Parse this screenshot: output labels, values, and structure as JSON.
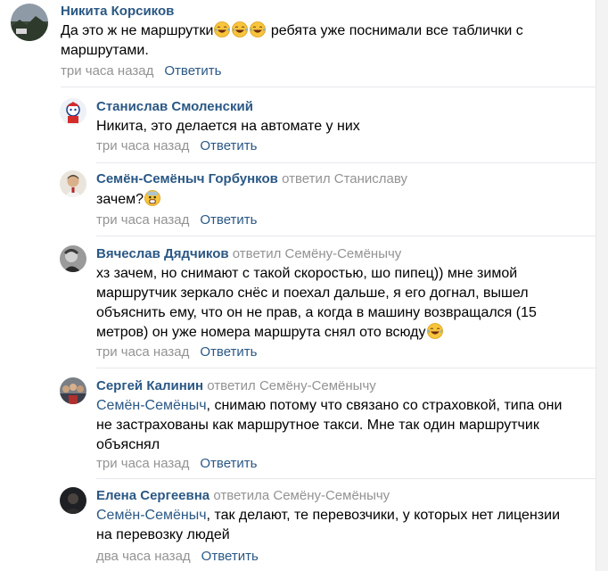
{
  "comments": [
    {
      "author": "Никита Корсиков",
      "reply_to": "",
      "text_before": "Да это ж не маршрутки",
      "emoji": [
        "laughing-crying",
        "laughing-crying",
        "laughing-crying"
      ],
      "text_after": " ребята уже поснимали все таблички с маршрутами.",
      "date": "три часа назад",
      "answer": "Ответить"
    },
    {
      "author": "Станислав Смоленский",
      "reply_to": "",
      "text": "Никита, это делается на автомате у них",
      "date": "три часа назад",
      "answer": "Ответить"
    },
    {
      "author": "Семён-Семёныч Горбунков",
      "reply_to": "ответил Станиславу",
      "text": "зачем?",
      "emoji": [
        "fearful"
      ],
      "date": "три часа назад",
      "answer": "Ответить"
    },
    {
      "author": "Вячеслав Дядчиков",
      "reply_to": "ответил Семёну-Семёнычу",
      "text": "хз зачем, но снимают с такой скоростью, шо пипец)) мне зимой маршрутчик зеркало снёс и поехал дальше, я его догнал, вышел объяснить ему, что он не прав, а когда в машину возвращался (15 метров) он уже номера маршрута снял ото всюду",
      "emoji": [
        "laughing-crying"
      ],
      "date": "три часа назад",
      "answer": "Ответить"
    },
    {
      "author": "Сергей Калинин",
      "reply_to": "ответил Семёну-Семёнычу",
      "mention": "Семён-Семёныч",
      "text": ", снимаю потому что связано со страховкой, типа они не застрахованы как маршрутное такси. Мне так один маршрутчик объяснял",
      "date": "три часа назад",
      "answer": "Ответить"
    },
    {
      "author": "Елена Сергеевна",
      "reply_to": "ответила Семёну-Семёнычу",
      "mention": "Семён-Семёныч",
      "text": ", так делают, те перевозчики, у которых нет лицензии на перевозку людей",
      "date": "два часа назад",
      "answer": "Ответить"
    }
  ],
  "colors": {
    "link": "#2a5885",
    "muted": "#939393",
    "divider": "#e7e8ec",
    "emoji_face": "#f7c43c"
  }
}
